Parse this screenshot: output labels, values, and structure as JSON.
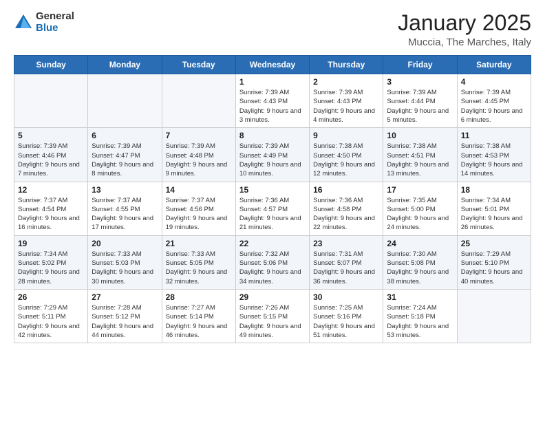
{
  "logo": {
    "general": "General",
    "blue": "Blue"
  },
  "title": {
    "month": "January 2025",
    "location": "Muccia, The Marches, Italy"
  },
  "weekdays": [
    "Sunday",
    "Monday",
    "Tuesday",
    "Wednesday",
    "Thursday",
    "Friday",
    "Saturday"
  ],
  "weeks": [
    [
      {
        "day": "",
        "info": ""
      },
      {
        "day": "",
        "info": ""
      },
      {
        "day": "",
        "info": ""
      },
      {
        "day": "1",
        "info": "Sunrise: 7:39 AM\nSunset: 4:43 PM\nDaylight: 9 hours and 3 minutes."
      },
      {
        "day": "2",
        "info": "Sunrise: 7:39 AM\nSunset: 4:43 PM\nDaylight: 9 hours and 4 minutes."
      },
      {
        "day": "3",
        "info": "Sunrise: 7:39 AM\nSunset: 4:44 PM\nDaylight: 9 hours and 5 minutes."
      },
      {
        "day": "4",
        "info": "Sunrise: 7:39 AM\nSunset: 4:45 PM\nDaylight: 9 hours and 6 minutes."
      }
    ],
    [
      {
        "day": "5",
        "info": "Sunrise: 7:39 AM\nSunset: 4:46 PM\nDaylight: 9 hours and 7 minutes."
      },
      {
        "day": "6",
        "info": "Sunrise: 7:39 AM\nSunset: 4:47 PM\nDaylight: 9 hours and 8 minutes."
      },
      {
        "day": "7",
        "info": "Sunrise: 7:39 AM\nSunset: 4:48 PM\nDaylight: 9 hours and 9 minutes."
      },
      {
        "day": "8",
        "info": "Sunrise: 7:39 AM\nSunset: 4:49 PM\nDaylight: 9 hours and 10 minutes."
      },
      {
        "day": "9",
        "info": "Sunrise: 7:38 AM\nSunset: 4:50 PM\nDaylight: 9 hours and 12 minutes."
      },
      {
        "day": "10",
        "info": "Sunrise: 7:38 AM\nSunset: 4:51 PM\nDaylight: 9 hours and 13 minutes."
      },
      {
        "day": "11",
        "info": "Sunrise: 7:38 AM\nSunset: 4:53 PM\nDaylight: 9 hours and 14 minutes."
      }
    ],
    [
      {
        "day": "12",
        "info": "Sunrise: 7:37 AM\nSunset: 4:54 PM\nDaylight: 9 hours and 16 minutes."
      },
      {
        "day": "13",
        "info": "Sunrise: 7:37 AM\nSunset: 4:55 PM\nDaylight: 9 hours and 17 minutes."
      },
      {
        "day": "14",
        "info": "Sunrise: 7:37 AM\nSunset: 4:56 PM\nDaylight: 9 hours and 19 minutes."
      },
      {
        "day": "15",
        "info": "Sunrise: 7:36 AM\nSunset: 4:57 PM\nDaylight: 9 hours and 21 minutes."
      },
      {
        "day": "16",
        "info": "Sunrise: 7:36 AM\nSunset: 4:58 PM\nDaylight: 9 hours and 22 minutes."
      },
      {
        "day": "17",
        "info": "Sunrise: 7:35 AM\nSunset: 5:00 PM\nDaylight: 9 hours and 24 minutes."
      },
      {
        "day": "18",
        "info": "Sunrise: 7:34 AM\nSunset: 5:01 PM\nDaylight: 9 hours and 26 minutes."
      }
    ],
    [
      {
        "day": "19",
        "info": "Sunrise: 7:34 AM\nSunset: 5:02 PM\nDaylight: 9 hours and 28 minutes."
      },
      {
        "day": "20",
        "info": "Sunrise: 7:33 AM\nSunset: 5:03 PM\nDaylight: 9 hours and 30 minutes."
      },
      {
        "day": "21",
        "info": "Sunrise: 7:33 AM\nSunset: 5:05 PM\nDaylight: 9 hours and 32 minutes."
      },
      {
        "day": "22",
        "info": "Sunrise: 7:32 AM\nSunset: 5:06 PM\nDaylight: 9 hours and 34 minutes."
      },
      {
        "day": "23",
        "info": "Sunrise: 7:31 AM\nSunset: 5:07 PM\nDaylight: 9 hours and 36 minutes."
      },
      {
        "day": "24",
        "info": "Sunrise: 7:30 AM\nSunset: 5:08 PM\nDaylight: 9 hours and 38 minutes."
      },
      {
        "day": "25",
        "info": "Sunrise: 7:29 AM\nSunset: 5:10 PM\nDaylight: 9 hours and 40 minutes."
      }
    ],
    [
      {
        "day": "26",
        "info": "Sunrise: 7:29 AM\nSunset: 5:11 PM\nDaylight: 9 hours and 42 minutes."
      },
      {
        "day": "27",
        "info": "Sunrise: 7:28 AM\nSunset: 5:12 PM\nDaylight: 9 hours and 44 minutes."
      },
      {
        "day": "28",
        "info": "Sunrise: 7:27 AM\nSunset: 5:14 PM\nDaylight: 9 hours and 46 minutes."
      },
      {
        "day": "29",
        "info": "Sunrise: 7:26 AM\nSunset: 5:15 PM\nDaylight: 9 hours and 49 minutes."
      },
      {
        "day": "30",
        "info": "Sunrise: 7:25 AM\nSunset: 5:16 PM\nDaylight: 9 hours and 51 minutes."
      },
      {
        "day": "31",
        "info": "Sunrise: 7:24 AM\nSunset: 5:18 PM\nDaylight: 9 hours and 53 minutes."
      },
      {
        "day": "",
        "info": ""
      }
    ]
  ]
}
